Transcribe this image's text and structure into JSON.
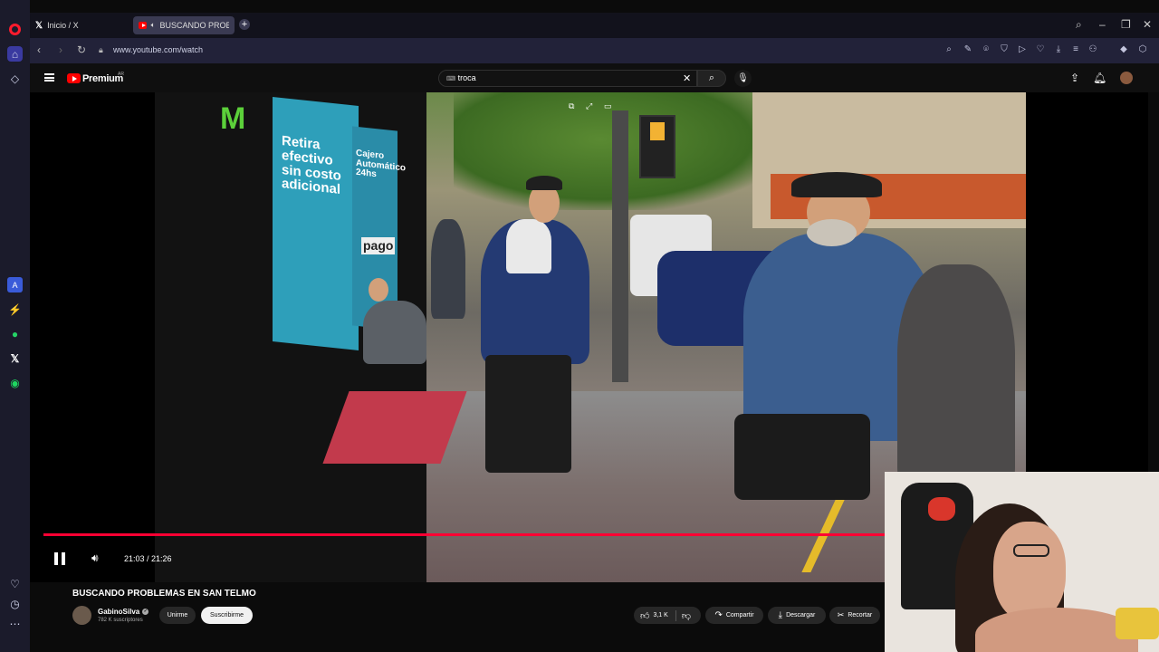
{
  "browser": {
    "tabs": [
      {
        "label": "Inicio / X"
      },
      {
        "label": "BUSCANDO PROBLEM"
      }
    ],
    "url": "www.youtube.com/watch"
  },
  "youtube": {
    "brand": "Premium",
    "region": "AR",
    "search_query": "troca"
  },
  "video": {
    "time_display": "21:03 / 21:26",
    "progress_fraction": 0.98,
    "overlay_text": {
      "sign_main": "Retira efectivo sin costo adicional",
      "sign_cajero": "Cajero Automático 24hs",
      "sign_pago": "pago"
    }
  },
  "meta": {
    "title": "BUSCANDO PROBLEMAS EN SAN TELMO",
    "channel": "GabinoSilva",
    "subscribers": "782 K suscriptores",
    "join_label": "Unirme",
    "subscribe_label": "Suscribirme",
    "likes": "3,1 K",
    "share_label": "Compartir",
    "download_label": "Descargar",
    "clip_label": "Recortar"
  },
  "colors": {
    "yt_red": "#ff0000",
    "progress_red": "#ff0033",
    "opera_red": "#ff1b2d"
  }
}
